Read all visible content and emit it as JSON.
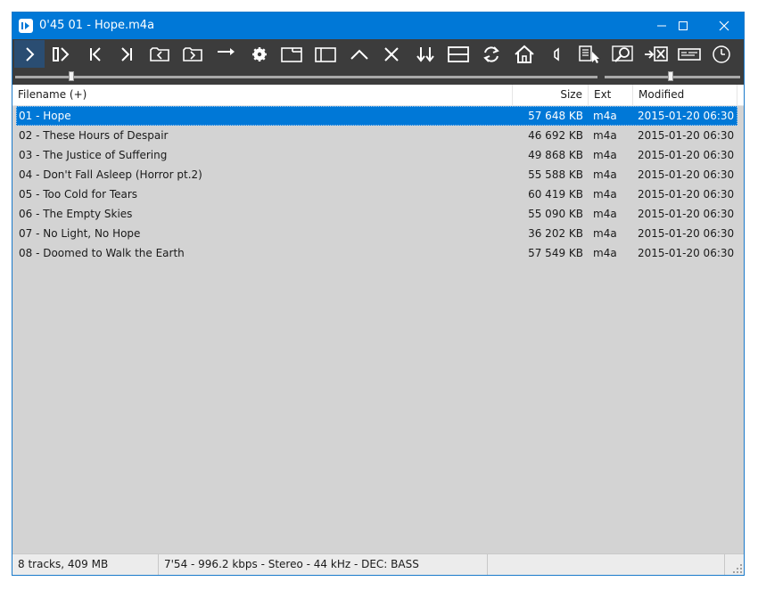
{
  "window": {
    "title": "0'45 01 - Hope.m4a",
    "colors": {
      "titlebar": "#0078d7",
      "toolbar": "#3c3c3c",
      "selection": "#0078d7",
      "list_bg": "#d3d3d3"
    }
  },
  "toolbar": {
    "buttons": [
      "play-icon",
      "play-pause-icon",
      "previous-track-icon",
      "next-track-icon",
      "folder-back-icon",
      "folder-forward-icon",
      "arrow-right-icon",
      "gear-icon",
      "window-icon",
      "sidebar-icon",
      "chevron-up-icon",
      "close-x-icon",
      "sort-icon",
      "split-view-icon",
      "repeat-icon",
      "home-icon",
      "speaker-icon",
      "playlist-cursor-icon",
      "search-icon",
      "remove-file-icon",
      "keyboard-icon",
      "clock-icon"
    ]
  },
  "seek": {
    "position_fraction": 0.097,
    "volume_fraction": 0.49
  },
  "columns": {
    "filename": "Filename (+)",
    "size": "Size",
    "ext": "Ext",
    "modified": "Modified"
  },
  "tracks": [
    {
      "name": "01 - Hope",
      "size": "57 648 KB",
      "ext": "m4a",
      "modified": "2015-01-20 06:30"
    },
    {
      "name": "02 - These Hours of Despair",
      "size": "46 692 KB",
      "ext": "m4a",
      "modified": "2015-01-20 06:30"
    },
    {
      "name": "03 - The Justice of Suffering",
      "size": "49 868 KB",
      "ext": "m4a",
      "modified": "2015-01-20 06:30"
    },
    {
      "name": "04 - Don't Fall Asleep (Horror pt.2)",
      "size": "55 588 KB",
      "ext": "m4a",
      "modified": "2015-01-20 06:30"
    },
    {
      "name": "05 - Too Cold for Tears",
      "size": "60 419 KB",
      "ext": "m4a",
      "modified": "2015-01-20 06:30"
    },
    {
      "name": "06 - The Empty Skies",
      "size": "55 090 KB",
      "ext": "m4a",
      "modified": "2015-01-20 06:30"
    },
    {
      "name": "07 - No Light, No Hope",
      "size": "36 202 KB",
      "ext": "m4a",
      "modified": "2015-01-20 06:30"
    },
    {
      "name": "08 - Doomed to Walk the Earth",
      "size": "57 549 KB",
      "ext": "m4a",
      "modified": "2015-01-20 06:30"
    }
  ],
  "status": {
    "summary": "8 tracks, 409 MB",
    "info": "7'54 - 996.2 kbps - Stereo - 44 kHz - DEC: BASS",
    "extra": ""
  }
}
